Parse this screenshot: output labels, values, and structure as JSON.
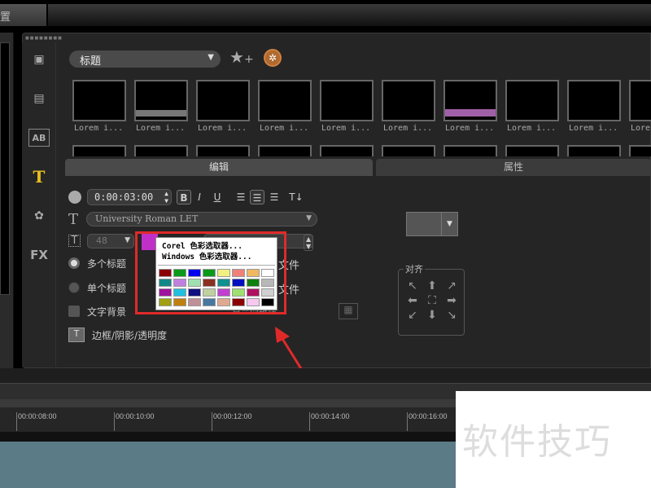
{
  "topbar": {
    "tab_label": "置"
  },
  "library": {
    "category": "标题",
    "add_favorite_icon": "star-plus-icon",
    "library_icon": "film-reel-icon",
    "thumbnails": [
      "Lorem i...",
      "Lorem i...",
      "Lorem i...",
      "Lorem i...",
      "Lorem i...",
      "Lorem i...",
      "Lorem i...",
      "Lorem i...",
      "Lorem i...",
      "Lore"
    ]
  },
  "side_icons": [
    "media-icon",
    "transition-icon",
    "AB",
    "T",
    "graphics-icon",
    "FX"
  ],
  "tabs": {
    "edit": "编辑",
    "properties": "属性"
  },
  "edit": {
    "duration": "0:00:03:00",
    "font": "University Roman LET",
    "font_size": "48",
    "bold": "B",
    "italic": "I",
    "underline": "U",
    "multi_title": "多个标题",
    "single_title": "单个标题",
    "text_background": "文字背景",
    "border_shadow": "边框/阴影/透明度",
    "file_label1": "文件",
    "file_label2": "文件",
    "show_grid": "显示网格线",
    "text_color": "#c030c8"
  },
  "color_popup": {
    "corel": "Corel 色彩选取器...",
    "windows": "Windows 色彩选取器...",
    "swatches": [
      "#8b0000",
      "#0a9a1a",
      "#0000ee",
      "#0a9a1a",
      "#f0f080",
      "#f08078",
      "#f0b860",
      "#ffffff",
      "#108888",
      "#c080e0",
      "#a0e0b0",
      "#8b3020",
      "#109090",
      "#0010c0",
      "#108010",
      "#b8b8b8",
      "#a010a0",
      "#20c0e0",
      "#101080",
      "#c0d0a0",
      "#c040d0",
      "#a0e070",
      "#b01060",
      "#d0d0d0",
      "#a0a010",
      "#c08010",
      "#c09098",
      "#4878a0",
      "#e0a890",
      "#8b0000",
      "#f8c8f0",
      "#000000"
    ]
  },
  "alignment": {
    "title": "对齐",
    "arrows": [
      "↖",
      "⬆",
      "↗",
      "⬅",
      "⛶",
      "➡",
      "↙",
      "⬇",
      "↘"
    ]
  },
  "timeline": {
    "ticks": [
      "00:00:08:00",
      "00:00:10:00",
      "00:00:12:00",
      "00:00:14:00",
      "00:00:16:00"
    ]
  },
  "watermark": "软件技巧"
}
